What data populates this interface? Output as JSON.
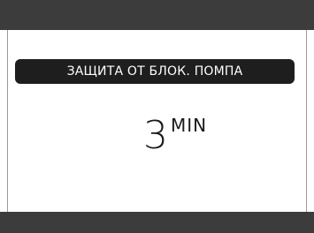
{
  "setting": {
    "title": "ЗАЩИТА ОТ БЛОК. ПОМПА",
    "value": "3",
    "unit": "MIN"
  },
  "colors": {
    "bar": "#3c3c3c",
    "banner": "#1e1e1e",
    "background": "#ffffff",
    "text": "#1a1a1a"
  }
}
